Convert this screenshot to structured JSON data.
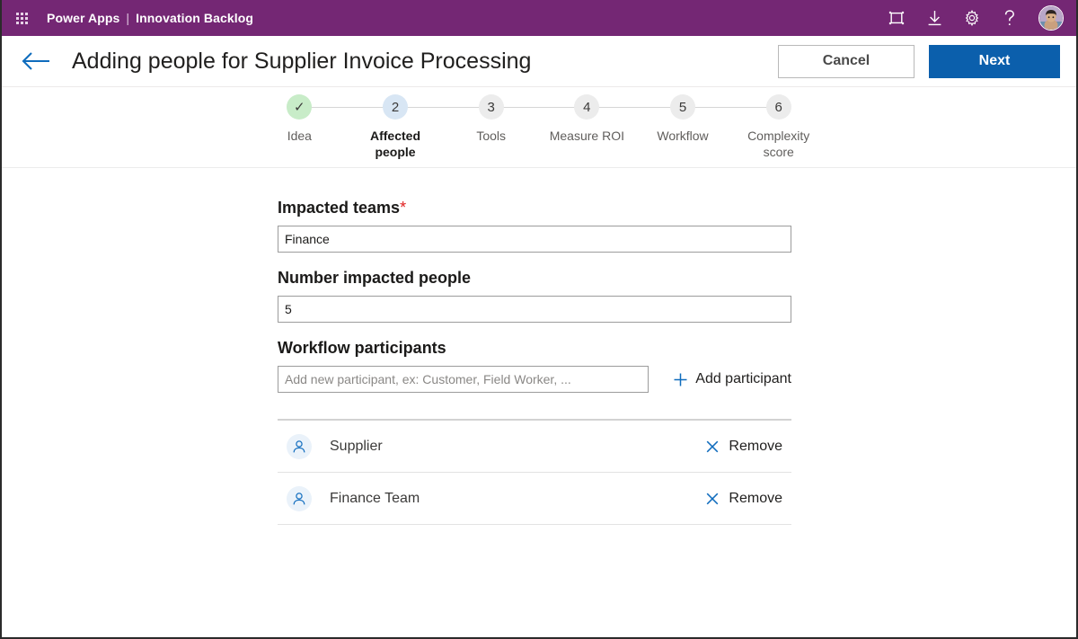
{
  "suitebar": {
    "waffle_icon": "waffle-grid-icon",
    "brand": "Power Apps",
    "divider": "|",
    "app_name": "Innovation Backlog",
    "icons": [
      {
        "name": "screen-frame-icon",
        "label": "Screen"
      },
      {
        "name": "download-icon",
        "label": "Download"
      },
      {
        "name": "gear-icon",
        "label": "Settings"
      },
      {
        "name": "help-icon",
        "label": "Help"
      }
    ],
    "avatar": "user-avatar",
    "bg_color": "#742774"
  },
  "titlebar": {
    "back_icon": "back-arrow-icon",
    "title": "Adding people for Supplier Invoice Processing",
    "cancel_label": "Cancel",
    "next_label": "Next",
    "next_color": "#0b5fac"
  },
  "stepper": {
    "steps": [
      {
        "number": "✓",
        "label": "Idea",
        "state": "done"
      },
      {
        "number": "2",
        "label": "Affected people",
        "state": "active"
      },
      {
        "number": "3",
        "label": "Tools",
        "state": "upcoming"
      },
      {
        "number": "4",
        "label": "Measure ROI",
        "state": "upcoming"
      },
      {
        "number": "5",
        "label": "Workflow",
        "state": "upcoming"
      },
      {
        "number": "6",
        "label": "Complexity score",
        "state": "upcoming"
      }
    ],
    "done_color": "#c8ecc8",
    "active_color": "#d8e6f4",
    "upcoming_color": "#ececec"
  },
  "form": {
    "impacted_teams": {
      "label": "Impacted teams",
      "required_marker": "*",
      "value": "Finance",
      "placeholder": ""
    },
    "number_impacted_people": {
      "label": "Number impacted people",
      "value": "5",
      "placeholder": ""
    },
    "workflow_participants": {
      "label": "Workflow participants",
      "value": "",
      "placeholder": "Add new participant, ex: Customer, Field Worker, ...",
      "add_label": "Add participant",
      "add_icon": "plus-icon"
    }
  },
  "participants": {
    "remove_label": "Remove",
    "remove_icon": "close-x-icon",
    "person_icon": "person-icon",
    "items": [
      {
        "name": "Supplier"
      },
      {
        "name": "Finance Team"
      }
    ]
  },
  "colors": {
    "accent_blue": "#0f6cbd",
    "brand_purple": "#742774",
    "required_red": "#e01f1f"
  }
}
